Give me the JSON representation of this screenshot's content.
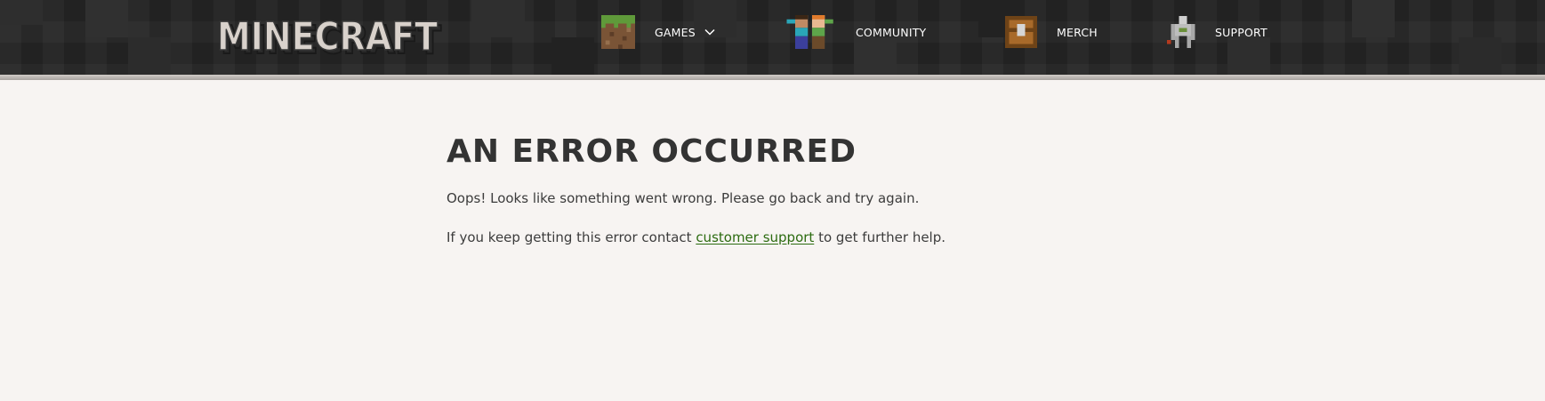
{
  "header": {
    "logo_text": "MINECRAFT",
    "nav": [
      {
        "label": "GAMES",
        "icon": "grass-block-icon",
        "has_dropdown": true
      },
      {
        "label": "COMMUNITY",
        "icon": "steve-alex-icon",
        "has_dropdown": false
      },
      {
        "label": "MERCH",
        "icon": "chest-icon",
        "has_dropdown": false
      },
      {
        "label": "SUPPORT",
        "icon": "iron-golem-icon",
        "has_dropdown": false
      }
    ]
  },
  "error": {
    "title": "AN ERROR OCCURRED",
    "message": "Oops! Looks like something went wrong. Please go back and try again.",
    "contact_prefix": "If you keep getting this error contact ",
    "contact_link": "customer support",
    "contact_suffix": " to get further help."
  },
  "colors": {
    "header_bg": "#262626",
    "page_bg": "#f7f4f2",
    "link": "#2c6b10",
    "text": "#333333"
  }
}
